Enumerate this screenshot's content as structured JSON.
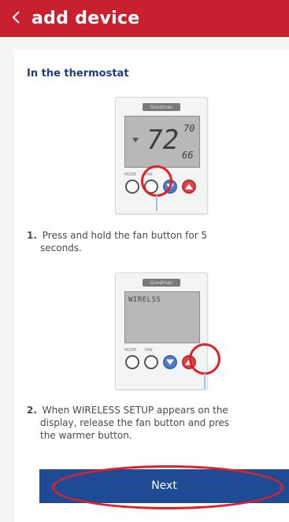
{
  "header": {
    "title": "add device",
    "bg_color": "#c8202f"
  },
  "section": {
    "title": "In the thermostat"
  },
  "device1": {
    "brand": "Goodman",
    "temp_main": "72",
    "temp_upper": "70",
    "temp_lower": "66",
    "btn_labels": [
      "MODE",
      "FAN"
    ]
  },
  "step1": {
    "num": "1.",
    "line1": "Press and hold the fan button for 5",
    "line2": "seconds."
  },
  "device2": {
    "brand": "Goodman",
    "lcd": "WIRELSS",
    "btn_labels": [
      "MODE",
      "FAN"
    ]
  },
  "step2": {
    "num": "2.",
    "line1": "When WIRELESS SETUP appears on the",
    "line2": "display, release the fan button and pres",
    "line3": "the warmer button."
  },
  "buttons": {
    "next": "Next"
  },
  "colors": {
    "accent_red": "#e01f27",
    "primary_blue": "#1f4b95"
  }
}
